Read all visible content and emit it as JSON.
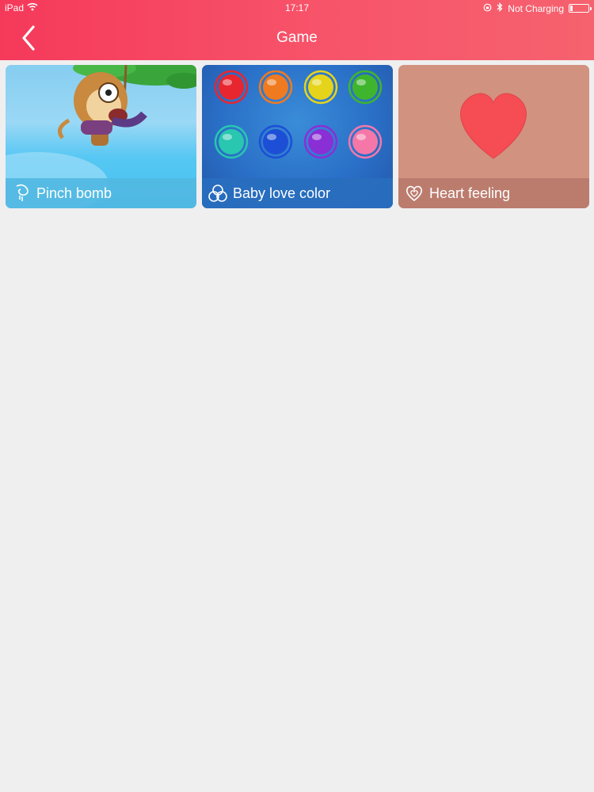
{
  "status_bar": {
    "device": "iPad",
    "time": "17:17",
    "battery_status": "Not Charging"
  },
  "nav": {
    "title": "Game",
    "back_icon": "chevron-left-icon"
  },
  "games": [
    {
      "label": "Pinch bomb",
      "icon": "bomb-icon"
    },
    {
      "label": "Baby love color",
      "icon": "circles-icon"
    },
    {
      "label": "Heart feeling",
      "icon": "heart-outline-icon"
    }
  ],
  "colors": {
    "header": "#f5395a",
    "background": "#efeff0",
    "heart": "#f64d55",
    "gems": [
      "#e8262f",
      "#f07a1f",
      "#e6d41a",
      "#3fb52d",
      "#29c6b0",
      "#1c4fd6",
      "#8a2fd6",
      "#f577a8"
    ]
  }
}
